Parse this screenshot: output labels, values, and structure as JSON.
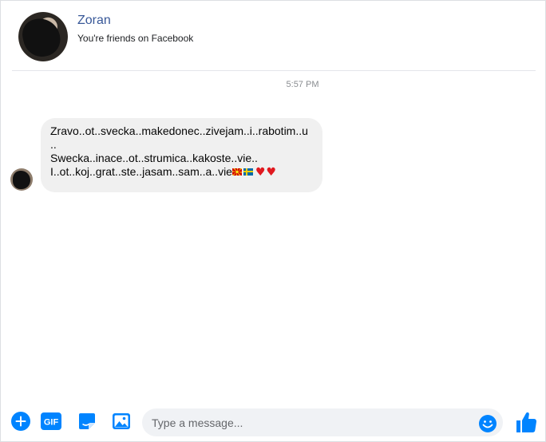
{
  "header": {
    "name": "Zoran",
    "subtitle": "You're friends on Facebook"
  },
  "timestamp": "5:57 PM",
  "message": {
    "line1": "Zravo..ot..svecka..makedonec..zivejam..i..rabotim..u",
    "line2": "..",
    "line3": "Swecka..inace..ot..strumica..kakoste..vie..",
    "line4": "I..ot..koj..grat..ste..jasam..sam..a..vie",
    "emojis": [
      "macedonia-flag",
      "sweden-flag",
      "red-heart",
      "red-heart"
    ]
  },
  "composer": {
    "placeholder": "Type a message...",
    "gif_label": "GIF"
  },
  "colors": {
    "accent": "#0084ff",
    "name_link": "#385898",
    "bubble_bg": "#f0f0f0",
    "input_bg": "#f0f2f5",
    "heart": "#e0191f"
  }
}
